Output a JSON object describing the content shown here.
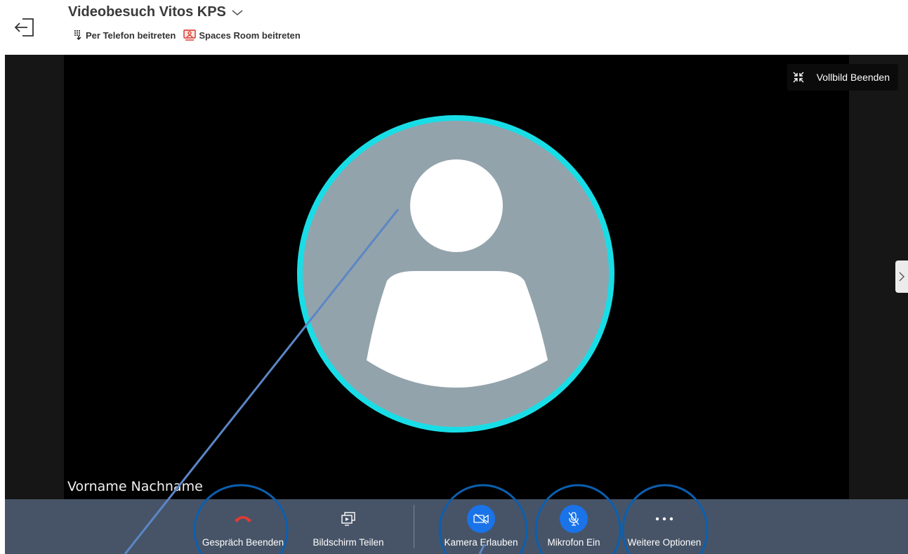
{
  "header": {
    "title": "Videobesuch Vitos KPS",
    "phone_join": "Per Telefon beitreten",
    "spaces_join": "Spaces Room beitreten"
  },
  "video": {
    "participant_name": "Vorname Nachname",
    "fullscreen_exit": "Vollbild Beenden"
  },
  "toolbar": {
    "end_call": "Gespräch Beenden",
    "share_screen": "Bildschirm Teilen",
    "allow_camera": "Kamera Erlauben",
    "mic_on": "Mikrofon Ein",
    "more_options": "Weitere Optionen"
  },
  "colors": {
    "accent_blue": "#1a73e8",
    "speaking_ring": "#19dde6",
    "toolbar_bg": "#475467",
    "end_call_red": "#e53935"
  }
}
